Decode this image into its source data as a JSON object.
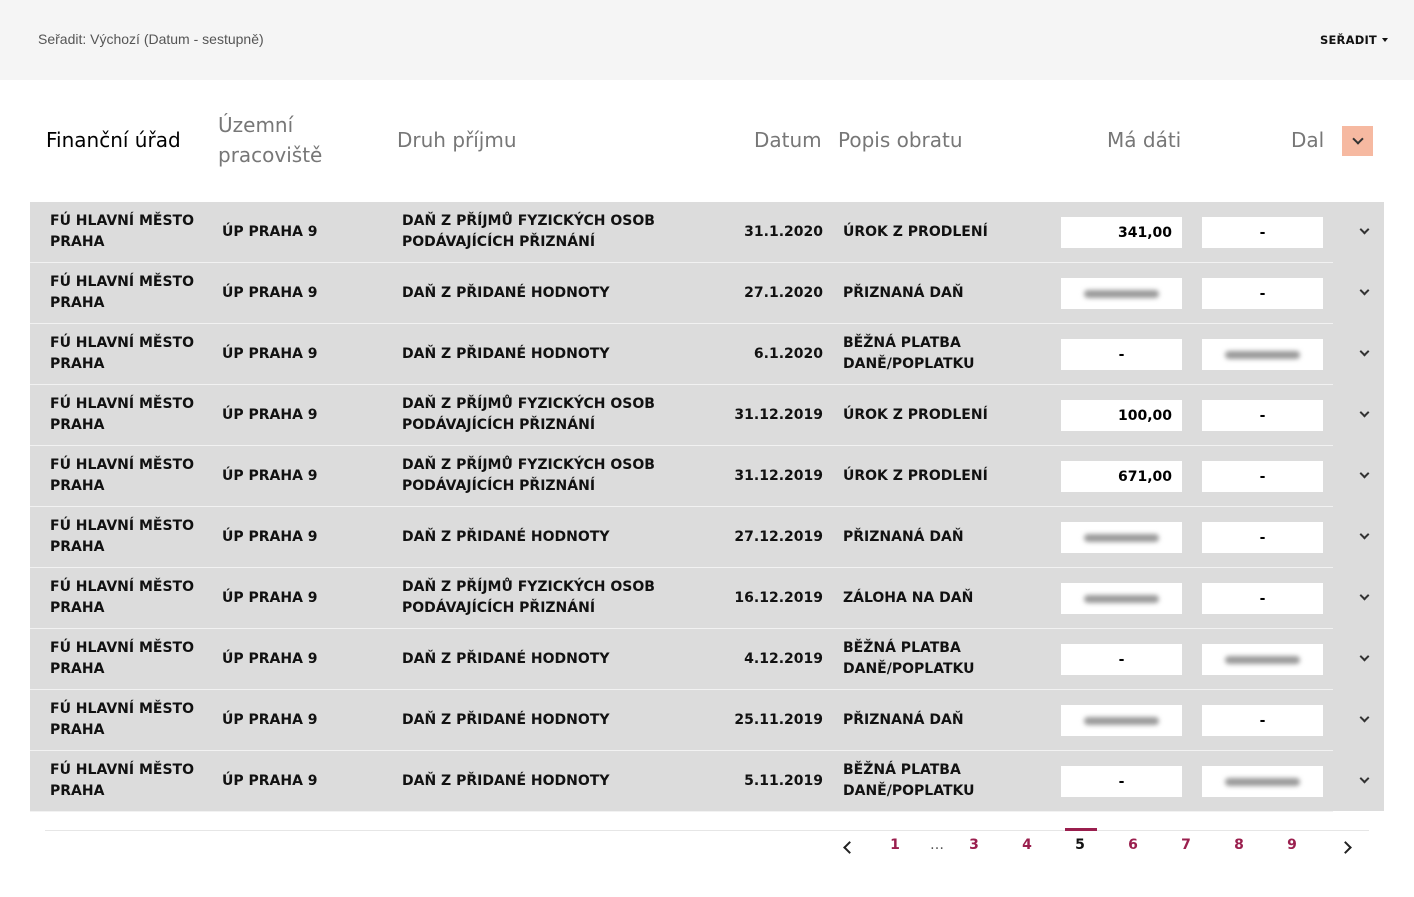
{
  "toolbar": {
    "sort_info": "Seřadit: Výchozí (Datum - sestupně)",
    "sort_button": "SEŘADIT"
  },
  "headers": {
    "financni_urad": "Finanční úřad",
    "uzemni_line1": "Územní",
    "uzemni_line2": "pracoviště",
    "druh_prijmu": "Druh příjmu",
    "datum": "Datum",
    "popis_obratu": "Popis obratu",
    "ma_dati": "Má dáti",
    "dal": "Dal"
  },
  "rows": [
    {
      "fu": "FÚ HLAVNÍ MĚSTO PRAHA",
      "up": "ÚP PRAHA 9",
      "druh": "DAŇ Z PŘÍJMŮ FYZICKÝCH OSOB PODÁVAJÍCÍCH PŘIZNÁNÍ",
      "datum": "31.1.2020",
      "popis": "ÚROK Z PRODLENÍ",
      "ma_dati": "341,00",
      "dal": "-"
    },
    {
      "fu": "FÚ HLAVNÍ MĚSTO PRAHA",
      "up": "ÚP PRAHA 9",
      "druh": "DAŇ Z PŘIDANÉ HODNOTY",
      "datum": "27.1.2020",
      "popis": "PŘIZNANÁ DAŇ",
      "ma_dati": "",
      "dal": "-"
    },
    {
      "fu": "FÚ HLAVNÍ MĚSTO PRAHA",
      "up": "ÚP PRAHA 9",
      "druh": "DAŇ Z PŘIDANÉ HODNOTY",
      "datum": "6.1.2020",
      "popis": "BĚŽNÁ PLATBA DANĚ/POPLATKU",
      "ma_dati": "-",
      "dal": ""
    },
    {
      "fu": "FÚ HLAVNÍ MĚSTO PRAHA",
      "up": "ÚP PRAHA 9",
      "druh": "DAŇ Z PŘÍJMŮ FYZICKÝCH OSOB PODÁVAJÍCÍCH PŘIZNÁNÍ",
      "datum": "31.12.2019",
      "popis": "ÚROK Z PRODLENÍ",
      "ma_dati": "100,00",
      "dal": "-"
    },
    {
      "fu": "FÚ HLAVNÍ MĚSTO PRAHA",
      "up": "ÚP PRAHA 9",
      "druh": "DAŇ Z PŘÍJMŮ FYZICKÝCH OSOB PODÁVAJÍCÍCH PŘIZNÁNÍ",
      "datum": "31.12.2019",
      "popis": "ÚROK Z PRODLENÍ",
      "ma_dati": "671,00",
      "dal": "-"
    },
    {
      "fu": "FÚ HLAVNÍ MĚSTO PRAHA",
      "up": "ÚP PRAHA 9",
      "druh": "DAŇ Z PŘIDANÉ HODNOTY",
      "datum": "27.12.2019",
      "popis": "PŘIZNANÁ DAŇ",
      "ma_dati": "",
      "dal": "-"
    },
    {
      "fu": "FÚ HLAVNÍ MĚSTO PRAHA",
      "up": "ÚP PRAHA 9",
      "druh": "DAŇ Z PŘÍJMŮ FYZICKÝCH OSOB PODÁVAJÍCÍCH PŘIZNÁNÍ",
      "datum": "16.12.2019",
      "popis": "ZÁLOHA NA DAŇ",
      "ma_dati": "",
      "dal": "-"
    },
    {
      "fu": "FÚ HLAVNÍ MĚSTO PRAHA",
      "up": "ÚP PRAHA 9",
      "druh": "DAŇ Z PŘIDANÉ HODNOTY",
      "datum": "4.12.2019",
      "popis": "BĚŽNÁ PLATBA DANĚ/POPLATKU",
      "ma_dati": "-",
      "dal": ""
    },
    {
      "fu": "FÚ HLAVNÍ MĚSTO PRAHA",
      "up": "ÚP PRAHA 9",
      "druh": "DAŇ Z PŘIDANÉ HODNOTY",
      "datum": "25.11.2019",
      "popis": "PŘIZNANÁ DAŇ",
      "ma_dati": "",
      "dal": "-"
    },
    {
      "fu": "FÚ HLAVNÍ MĚSTO PRAHA",
      "up": "ÚP PRAHA 9",
      "druh": "DAŇ Z PŘIDANÉ HODNOTY",
      "datum": "5.11.2019",
      "popis": "BĚŽNÁ PLATBA DANĚ/POPLATKU",
      "ma_dati": "-",
      "dal": ""
    }
  ],
  "pagination": {
    "pages": [
      "1",
      "3",
      "4",
      "5",
      "6",
      "7",
      "8",
      "9"
    ],
    "ellipsis": "…",
    "current": "5"
  },
  "colors": {
    "accent": "#9a1f4e",
    "toggle": "#f6b9a1",
    "row_bg": "#dcdcdc"
  }
}
